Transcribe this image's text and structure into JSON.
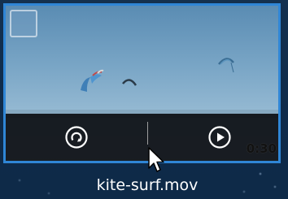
{
  "video_tile": {
    "filename": "kite-surf.mov",
    "duration": "0:30",
    "selected": false,
    "accent_color": "#2f86d6"
  },
  "controls": {
    "rotate_icon": "rotate-icon",
    "play_icon": "play-icon"
  },
  "cursor": {
    "icon": "arrow-cursor-icon"
  }
}
